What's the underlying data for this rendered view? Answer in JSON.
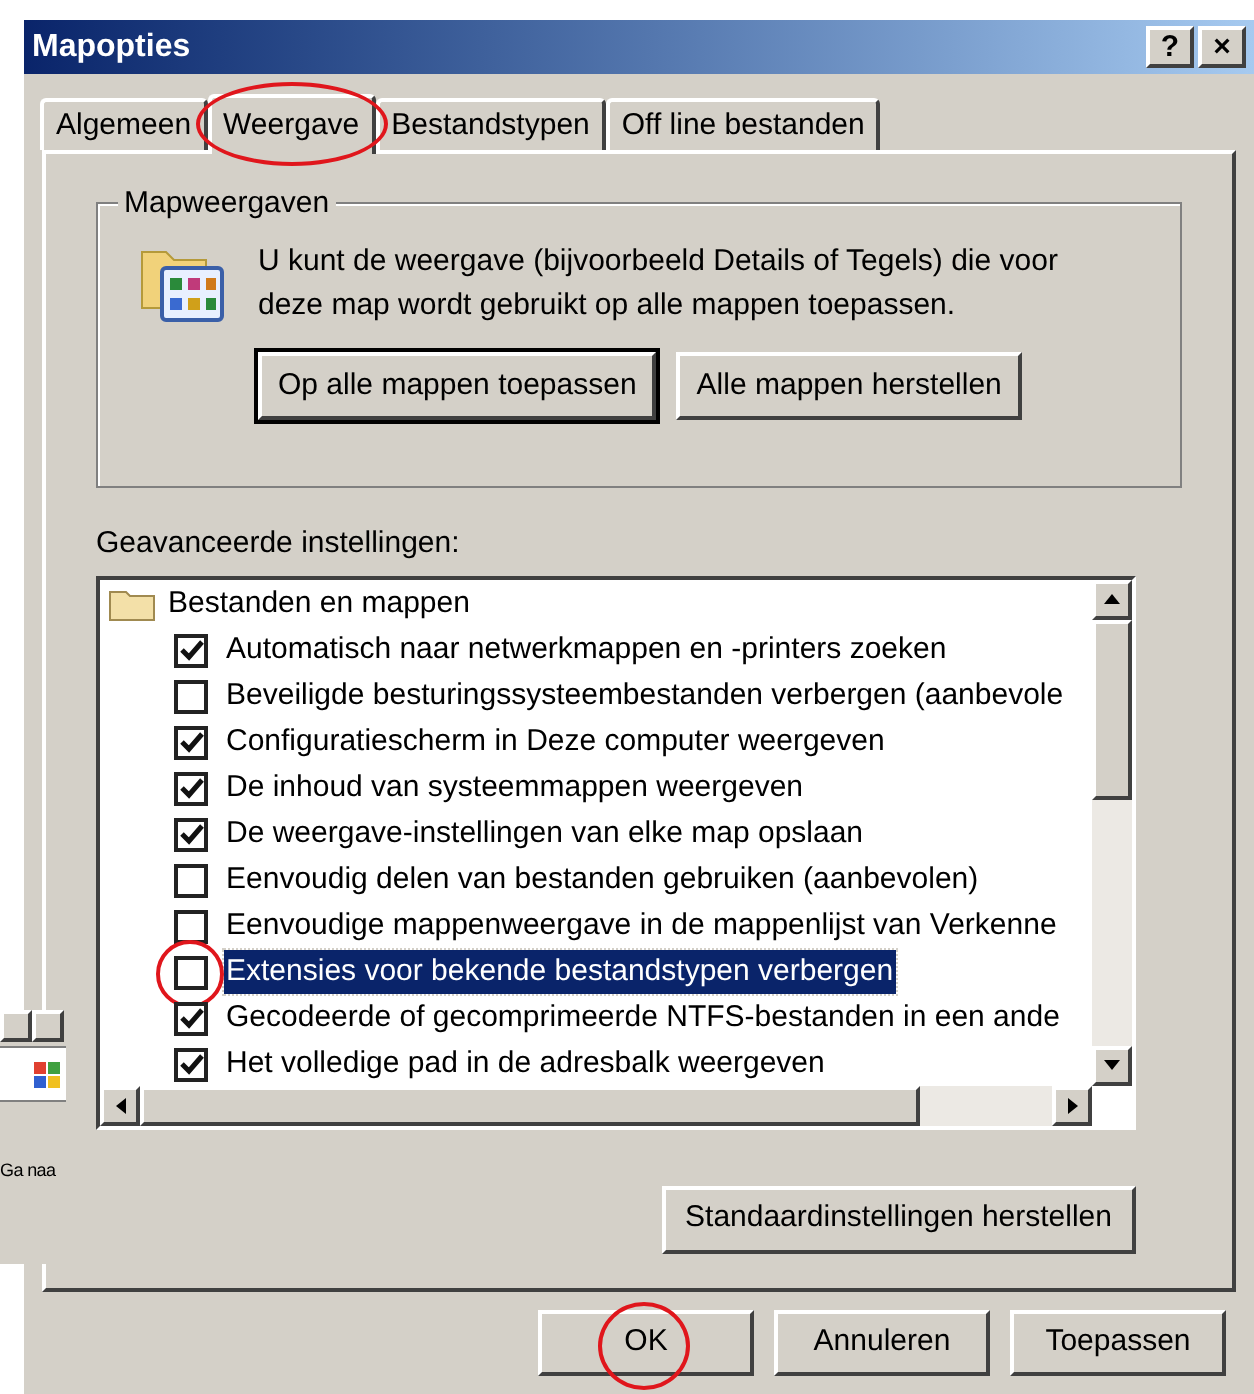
{
  "window": {
    "title": "Mapopties",
    "title_buttons": [
      "?",
      "×"
    ]
  },
  "tabs": [
    {
      "label": "Algemeen",
      "selected": false,
      "circled": false
    },
    {
      "label": "Weergave",
      "selected": true,
      "circled": true
    },
    {
      "label": "Bestandstypen",
      "selected": false,
      "circled": false
    },
    {
      "label": "Off line bestanden",
      "selected": false,
      "circled": false
    }
  ],
  "folder_views": {
    "title": "Mapweergaven",
    "description": "U kunt de weergave (bijvoorbeeld Details of Tegels) die voor deze map wordt gebruikt op alle mappen toepassen.",
    "buttons": [
      {
        "label": "Op alle mappen toepassen",
        "default": true
      },
      {
        "label": "Alle mappen herstellen",
        "default": false
      }
    ]
  },
  "advanced": {
    "label": "Geavanceerde instellingen:",
    "items": [
      {
        "kind": "folder",
        "label": "Bestanden en mappen"
      },
      {
        "kind": "checkbox",
        "label": "Automatisch naar netwerkmappen en -printers zoeken",
        "checked": true,
        "selected": false,
        "circled": false
      },
      {
        "kind": "checkbox",
        "label": "Beveiligde besturingssysteembestanden verbergen (aanbevole",
        "checked": false,
        "selected": false,
        "circled": false
      },
      {
        "kind": "checkbox",
        "label": "Configuratiescherm in Deze computer weergeven",
        "checked": true,
        "selected": false,
        "circled": false
      },
      {
        "kind": "checkbox",
        "label": "De inhoud van systeemmappen weergeven",
        "checked": true,
        "selected": false,
        "circled": false
      },
      {
        "kind": "checkbox",
        "label": "De weergave-instellingen van elke map opslaan",
        "checked": true,
        "selected": false,
        "circled": false
      },
      {
        "kind": "checkbox",
        "label": "Eenvoudig delen van bestanden gebruiken (aanbevolen)",
        "checked": false,
        "selected": false,
        "circled": false
      },
      {
        "kind": "checkbox",
        "label": "Eenvoudige mappenweergave in de mappenlijst van Verkenne",
        "checked": false,
        "selected": false,
        "circled": false
      },
      {
        "kind": "checkbox",
        "label": "Extensies voor bekende bestandstypen verbergen",
        "checked": false,
        "selected": true,
        "circled": true
      },
      {
        "kind": "checkbox",
        "label": "Gecodeerde of gecomprimeerde NTFS-bestanden in een ande",
        "checked": true,
        "selected": false,
        "circled": false
      },
      {
        "kind": "checkbox",
        "label": "Het volledige pad in de adresbalk weergeven",
        "checked": true,
        "selected": false,
        "circled": false
      }
    ],
    "restore_button": "Standaardinstellingen herstellen"
  },
  "footer_buttons": [
    {
      "label": "OK",
      "circled": true
    },
    {
      "label": "Annuleren",
      "circled": false
    },
    {
      "label": "Toepassen",
      "circled": false
    }
  ],
  "background_window": {
    "button": "Ga naa"
  }
}
